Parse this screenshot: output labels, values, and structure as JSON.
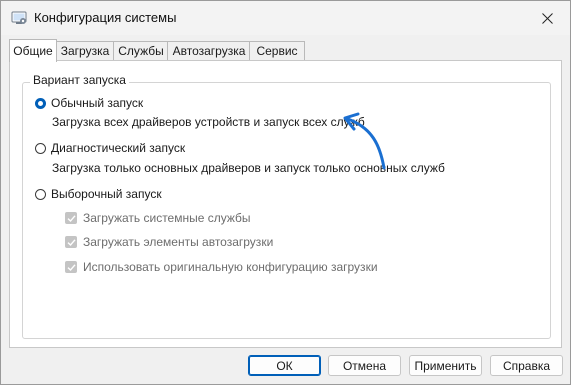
{
  "window": {
    "title": "Конфигурация системы"
  },
  "tabs": [
    {
      "label": "Общие",
      "active": true
    },
    {
      "label": "Загрузка",
      "active": false
    },
    {
      "label": "Службы",
      "active": false
    },
    {
      "label": "Автозагрузка",
      "active": false
    },
    {
      "label": "Сервис",
      "active": false
    }
  ],
  "startup_group": {
    "legend": "Вариант запуска",
    "normal": {
      "label": "Обычный запуск",
      "description": "Загрузка всех драйверов устройств и запуск всех служб",
      "selected": true
    },
    "diagnostic": {
      "label": "Диагностический запуск",
      "description": "Загрузка только основных драйверов и запуск только основных служб",
      "selected": false
    },
    "selective": {
      "label": "Выборочный запуск",
      "selected": false,
      "options": [
        {
          "label": "Загружать системные службы",
          "checked": true,
          "enabled": false
        },
        {
          "label": "Загружать элементы автозагрузки",
          "checked": true,
          "enabled": false
        },
        {
          "label": "Использовать оригинальную конфигурацию загрузки",
          "checked": true,
          "enabled": false
        }
      ]
    }
  },
  "buttons": {
    "ok": "ОК",
    "cancel": "Отмена",
    "apply": "Применить",
    "help": "Справка"
  },
  "colors": {
    "accent": "#005fb8",
    "annotation_arrow": "#1a6fd1"
  }
}
